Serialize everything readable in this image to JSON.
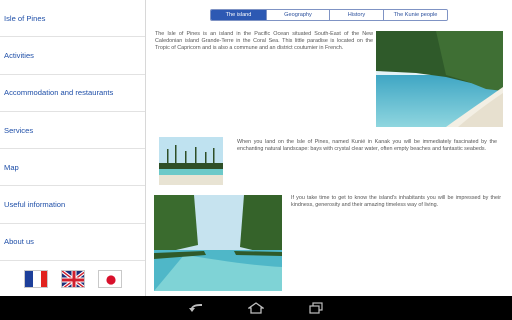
{
  "sidebar": {
    "items": [
      {
        "label": "Isle of Pines"
      },
      {
        "label": "Activities"
      },
      {
        "label": "Accommodation and restaurants"
      },
      {
        "label": "Services"
      },
      {
        "label": "Map"
      },
      {
        "label": "Useful information"
      },
      {
        "label": "About us"
      }
    ],
    "flags": [
      "flag-france-icon",
      "flag-uk-icon",
      "flag-japan-icon"
    ]
  },
  "tabs": [
    {
      "label": "The island",
      "active": true
    },
    {
      "label": "Geography",
      "active": false
    },
    {
      "label": "History",
      "active": false
    },
    {
      "label": "The Kunie people",
      "active": false
    }
  ],
  "content": {
    "paragraph1": "The Isle of Pines is an island in the Pacific Ocean situated South-East of the New Caledonian island Grande-Terre in the Coral Sea. This little paradise is located on the Tropic of Capricorn and is also a commune and an district coutumier in French.",
    "paragraph2": "When you land on the Isle of Pines, named Kunié in Kanak you will be immediately fascinated by the enchanting natural landscape: bays with crystal clear water, often empty beaches and fantastic seabeds.",
    "paragraph3": "If you take time to get to know the island's inhabitants you will be impressed by their kindness, generosity and their amazing timeless way of living."
  },
  "system_bar": {
    "buttons": [
      "back-icon",
      "home-icon",
      "recent-apps-icon"
    ]
  },
  "colors": {
    "accent": "#2d59b3",
    "link": "#1f4fa8",
    "text": "#555555"
  }
}
